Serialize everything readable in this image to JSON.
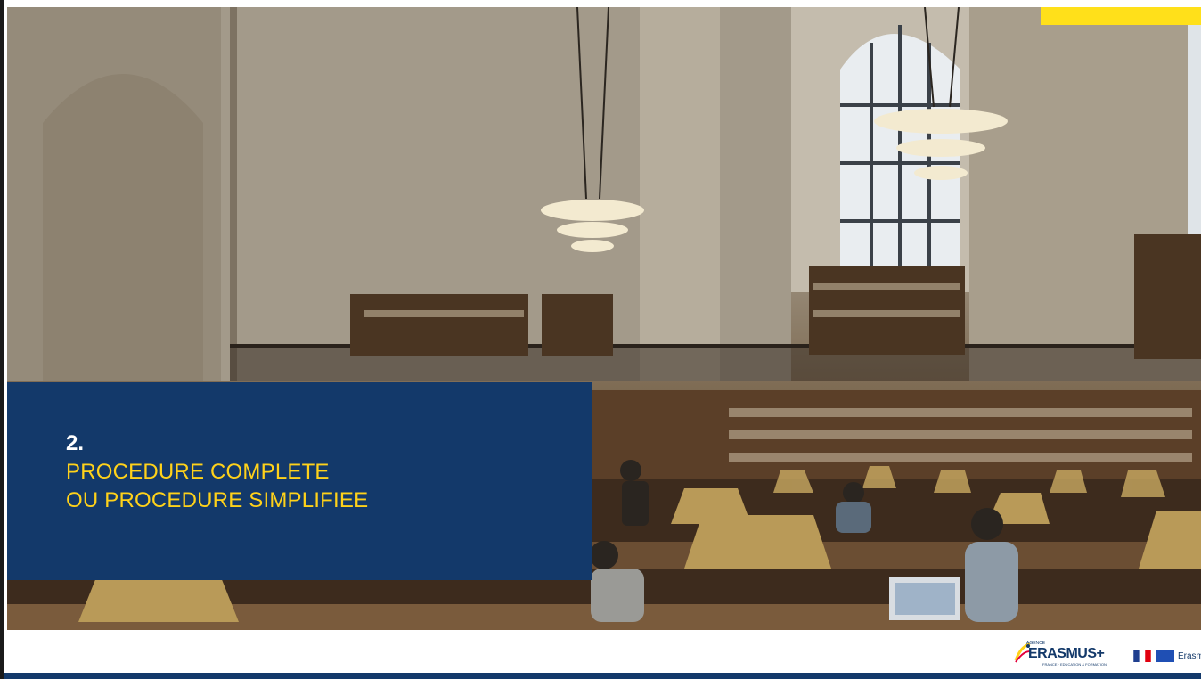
{
  "slide": {
    "number": "2.",
    "title_line_1": "PROCEDURE COMPLETE",
    "title_line_2": "OU PROCEDURE SIMPLIFIEE"
  },
  "footer": {
    "agence_label": "AGENCE",
    "brand": "ERASMUS+",
    "brand_sub": "FRANCE · EDUCATION & FORMATION",
    "eu_label": "Erasmus+"
  },
  "colors": {
    "navy": "#13396a",
    "yellow": "#ffd21a",
    "accent_tab": "#ffe01a"
  },
  "icons": [
    "erasmus-star-logo-icon",
    "french-flag-icon",
    "eu-flag-icon"
  ]
}
